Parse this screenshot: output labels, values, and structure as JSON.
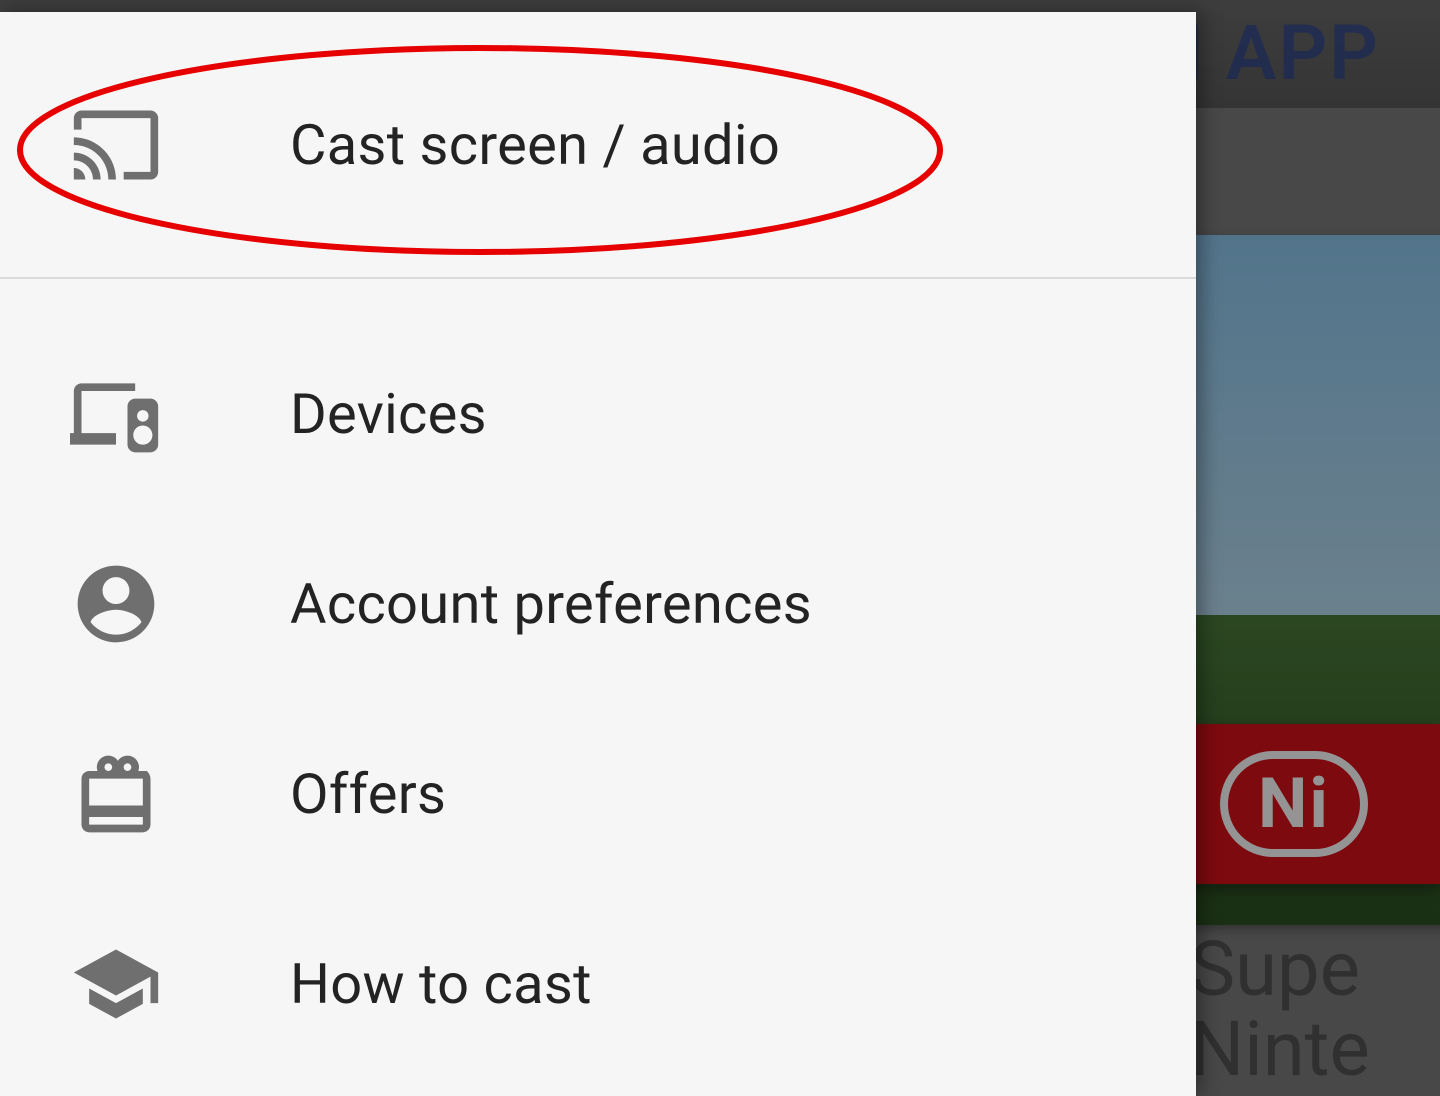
{
  "background": {
    "header_text_fragment": "EN APP",
    "badge_text_fragment": "Ni",
    "title_line1_fragment": "Supe",
    "title_line2_fragment": "Ninte"
  },
  "drawer": {
    "primary": {
      "label": "Cast screen / audio"
    },
    "items": [
      {
        "label": "Devices"
      },
      {
        "label": "Account preferences"
      },
      {
        "label": "Offers"
      },
      {
        "label": "How to cast"
      }
    ]
  },
  "annotation": {
    "highlight_target": "cast-screen-audio",
    "stroke": "#e60000"
  }
}
